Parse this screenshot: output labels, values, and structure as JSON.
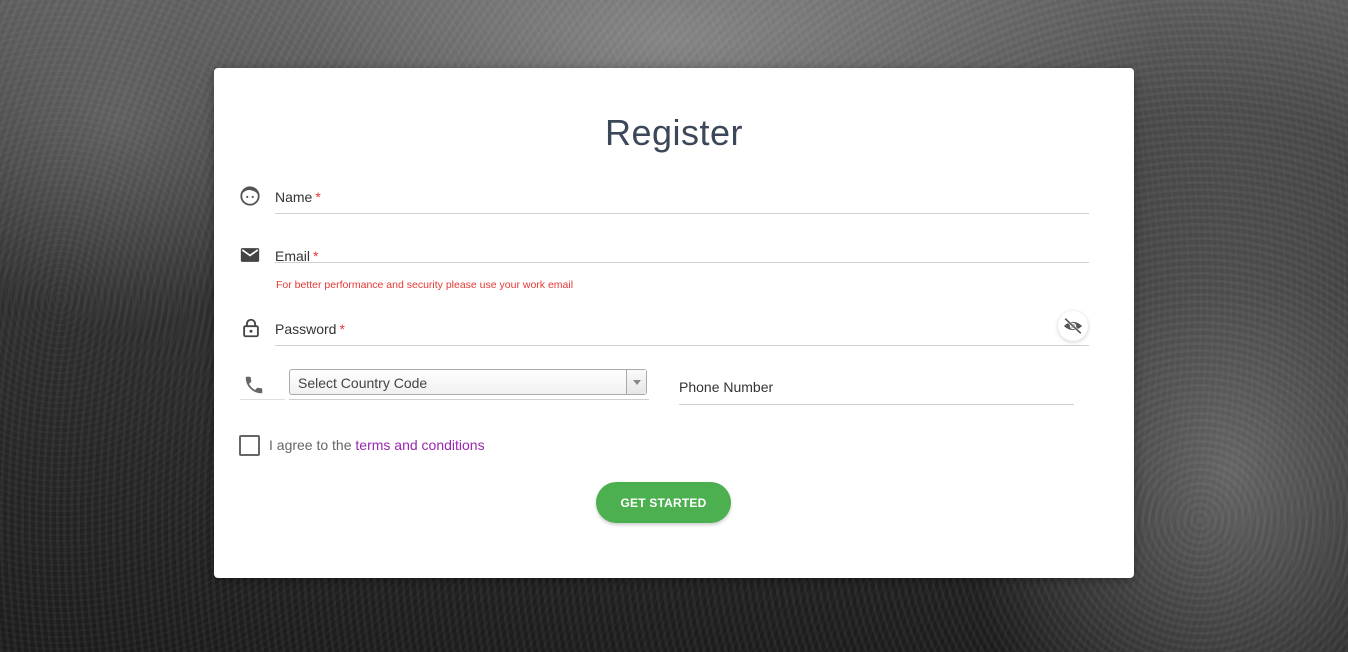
{
  "form": {
    "title": "Register",
    "name": {
      "label": "Name",
      "required_mark": "*",
      "value": ""
    },
    "email": {
      "label": "Email",
      "required_mark": "*",
      "value": "",
      "hint": "For better performance and security please use your work email"
    },
    "password": {
      "label": "Password",
      "required_mark": "*",
      "value": ""
    },
    "phone": {
      "country_code_placeholder": "Select Country Code",
      "number_label": "Phone Number",
      "value": ""
    },
    "agree": {
      "prefix": "I agree to the ",
      "link": "terms and conditions",
      "checked": false
    },
    "submit_label": "GET STARTED"
  },
  "icons": {
    "name": "face-icon",
    "email": "mail-icon",
    "password": "lock-icon",
    "password_toggle": "eye-off-icon",
    "phone": "phone-icon",
    "select_arrow": "dropdown-arrow-icon"
  },
  "colors": {
    "title": "#3c4858",
    "required": "#e53935",
    "hint": "#e53935",
    "link": "#9c27b0",
    "button": "#4caf50",
    "button_text": "#ffffff"
  }
}
